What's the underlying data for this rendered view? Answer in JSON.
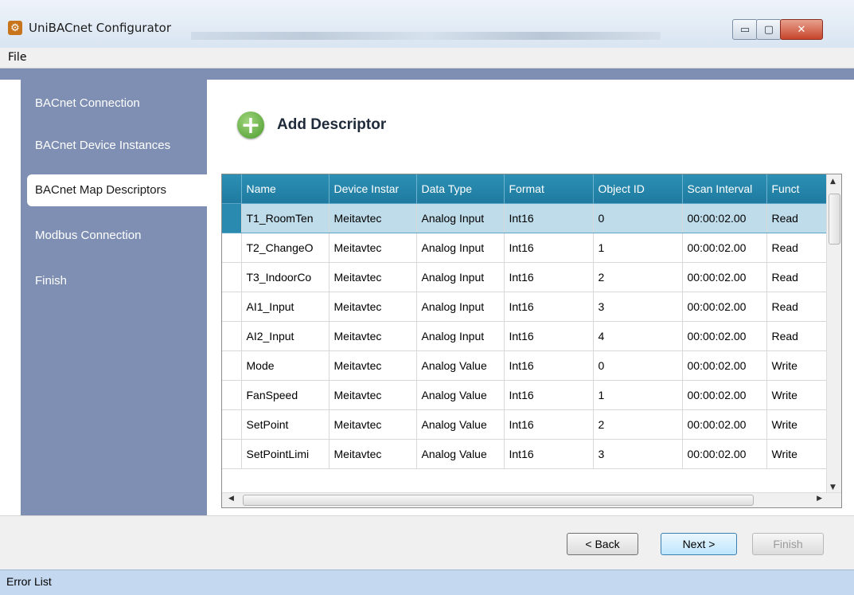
{
  "window": {
    "title": "UniBACnet Configurator",
    "min": "▭",
    "max": "▢",
    "close": "✕"
  },
  "menu": {
    "file": "File"
  },
  "sidebar": {
    "items": [
      {
        "label": "BACnet Connection"
      },
      {
        "label": "BACnet Device Instances"
      },
      {
        "label": "BACnet Map Descriptors",
        "active": true
      },
      {
        "label": "Modbus Connection"
      },
      {
        "label": "Finish"
      }
    ]
  },
  "main": {
    "add_label": "Add Descriptor",
    "plus_glyph": "+"
  },
  "grid": {
    "columns": [
      "Name",
      "Device Instar",
      "Data Type",
      "Format",
      "Object ID",
      "Scan Interval",
      "Funct"
    ],
    "rows": [
      [
        "T1_RoomTen",
        "Meitavtec",
        "Analog Input",
        "Int16",
        "0",
        "00:00:02.00",
        "Read"
      ],
      [
        "T2_ChangeO",
        "Meitavtec",
        "Analog Input",
        "Int16",
        "1",
        "00:00:02.00",
        "Read"
      ],
      [
        "T3_IndoorCo",
        "Meitavtec",
        "Analog Input",
        "Int16",
        "2",
        "00:00:02.00",
        "Read"
      ],
      [
        "AI1_Input",
        "Meitavtec",
        "Analog Input",
        "Int16",
        "3",
        "00:00:02.00",
        "Read"
      ],
      [
        "AI2_Input",
        "Meitavtec",
        "Analog Input",
        "Int16",
        "4",
        "00:00:02.00",
        "Read"
      ],
      [
        "Mode",
        "Meitavtec",
        "Analog Value",
        "Int16",
        "0",
        "00:00:02.00",
        "Write"
      ],
      [
        "FanSpeed",
        "Meitavtec",
        "Analog Value",
        "Int16",
        "1",
        "00:00:02.00",
        "Write"
      ],
      [
        "SetPoint",
        "Meitavtec",
        "Analog Value",
        "Int16",
        "2",
        "00:00:02.00",
        "Write"
      ],
      [
        "SetPointLimi",
        "Meitavtec",
        "Analog Value",
        "Int16",
        "3",
        "00:00:02.00",
        "Write"
      ]
    ],
    "selected_row": 0
  },
  "buttons": {
    "back": "< Back",
    "next": "Next >",
    "finish": "Finish"
  },
  "status": {
    "text": "Error List"
  },
  "colors": {
    "sidebar": "#7e8fb3",
    "grid_header": "#1f7aa0",
    "selected_row": "#bfdcea",
    "statusbar": "#c4d8ef"
  }
}
